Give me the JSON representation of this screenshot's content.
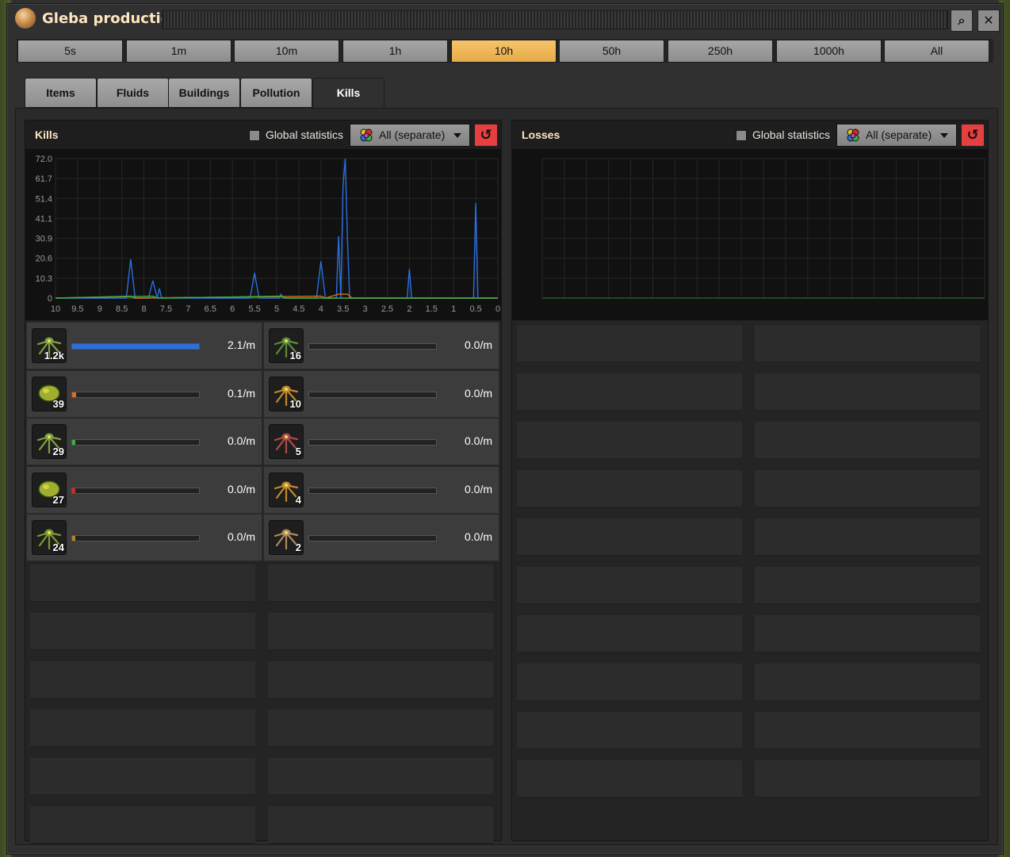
{
  "window": {
    "title": "Gleba production"
  },
  "titlebar": {
    "search_glyph": "⌕",
    "close_glyph": "✕"
  },
  "time_ranges": [
    "5s",
    "1m",
    "10m",
    "1h",
    "10h",
    "50h",
    "250h",
    "1000h",
    "All"
  ],
  "time_active": "10h",
  "tabs": [
    "Items",
    "Fluids",
    "Buildings",
    "Pollution",
    "Kills"
  ],
  "tab_active": "Kills",
  "kills": {
    "title": "Kills",
    "global_label": "Global statistics",
    "filter_label": "All (separate)",
    "reset_glyph": "↺",
    "rows": [
      {
        "count": "1.2k",
        "rate": "2.1/m",
        "fill": 1.0,
        "color": "#2a6fe0",
        "icon": "pentapod-icon",
        "tint": "#7fa040"
      },
      {
        "count": "16",
        "rate": "0.0/m",
        "fill": 0.0,
        "color": "#9b3cd6",
        "icon": "stomper-icon",
        "tint": "#5e8a3a"
      },
      {
        "count": "39",
        "rate": "0.1/m",
        "fill": 0.03,
        "color": "#e06a1a",
        "icon": "egg-raft-icon",
        "tint": "#9ab030"
      },
      {
        "count": "10",
        "rate": "0.0/m",
        "fill": 0.0,
        "color": "#2a6fe0",
        "icon": "pentapod-orange-icon",
        "tint": "#c08a2a"
      },
      {
        "count": "29",
        "rate": "0.0/m",
        "fill": 0.02,
        "color": "#3bb03b",
        "icon": "pentapod-icon",
        "tint": "#7fa040"
      },
      {
        "count": "5",
        "rate": "0.0/m",
        "fill": 0.0,
        "color": "#2a6fe0",
        "icon": "pentapod-red-icon",
        "tint": "#b04a4a"
      },
      {
        "count": "27",
        "rate": "0.0/m",
        "fill": 0.02,
        "color": "#d22a2a",
        "icon": "egg-raft-icon",
        "tint": "#9ab030"
      },
      {
        "count": "4",
        "rate": "0.0/m",
        "fill": 0.0,
        "color": "#2a6fe0",
        "icon": "pentapod-orange-icon",
        "tint": "#c08a2a"
      },
      {
        "count": "24",
        "rate": "0.0/m",
        "fill": 0.02,
        "color": "#b08a20",
        "icon": "stomper-icon",
        "tint": "#7a9a30"
      },
      {
        "count": "2",
        "rate": "0.0/m",
        "fill": 0.0,
        "color": "#2a6fe0",
        "icon": "pentapod-tan-icon",
        "tint": "#b08a60"
      }
    ]
  },
  "losses": {
    "title": "Losses",
    "global_label": "Global statistics",
    "filter_label": "All (separate)",
    "reset_glyph": "↺"
  },
  "chart_data": {
    "type": "line",
    "title": "",
    "xlabel": "",
    "ylabel": "",
    "x_ticks": [
      "10",
      "9.5",
      "9",
      "8.5",
      "8",
      "7.5",
      "7",
      "6.5",
      "6",
      "5.5",
      "5",
      "4.5",
      "4",
      "3.5",
      "3",
      "2.5",
      "2",
      "1.5",
      "1",
      "0.5",
      "0"
    ],
    "y_ticks": [
      "72.0",
      "61.7",
      "51.4",
      "41.1",
      "30.9",
      "20.6",
      "10.3",
      "0"
    ],
    "xlim": [
      10,
      0
    ],
    "ylim": [
      0,
      72.0
    ],
    "series": [
      {
        "color": "#2a6fe0",
        "points": [
          [
            10,
            0
          ],
          [
            8.4,
            0
          ],
          [
            8.3,
            20
          ],
          [
            8.2,
            0
          ],
          [
            7.9,
            0
          ],
          [
            7.8,
            9
          ],
          [
            7.7,
            0
          ],
          [
            7.65,
            5
          ],
          [
            7.6,
            0
          ],
          [
            5.6,
            0
          ],
          [
            5.5,
            13
          ],
          [
            5.4,
            0
          ],
          [
            4.95,
            0
          ],
          [
            4.9,
            2
          ],
          [
            4.85,
            0
          ],
          [
            4.1,
            0
          ],
          [
            4.0,
            19
          ],
          [
            3.9,
            0
          ],
          [
            3.65,
            0
          ],
          [
            3.6,
            32
          ],
          [
            3.55,
            0
          ],
          [
            3.5,
            58
          ],
          [
            3.45,
            72
          ],
          [
            3.4,
            30
          ],
          [
            3.35,
            0
          ],
          [
            2.05,
            0
          ],
          [
            2.0,
            15
          ],
          [
            1.95,
            0
          ],
          [
            0.55,
            0
          ],
          [
            0.5,
            49
          ],
          [
            0.45,
            0
          ],
          [
            0,
            0
          ]
        ]
      },
      {
        "color": "#e06a1a",
        "points": [
          [
            10,
            0
          ],
          [
            8.3,
            1
          ],
          [
            8.2,
            0
          ],
          [
            4.0,
            1
          ],
          [
            3.9,
            0
          ],
          [
            3.6,
            2
          ],
          [
            3.4,
            2
          ],
          [
            3.3,
            0
          ],
          [
            0,
            0
          ]
        ]
      },
      {
        "color": "#3bb03b",
        "points": [
          [
            10,
            0
          ],
          [
            7.8,
            1
          ],
          [
            7.7,
            0
          ],
          [
            4.9,
            1
          ],
          [
            4.8,
            0
          ],
          [
            0,
            0
          ]
        ]
      }
    ]
  }
}
